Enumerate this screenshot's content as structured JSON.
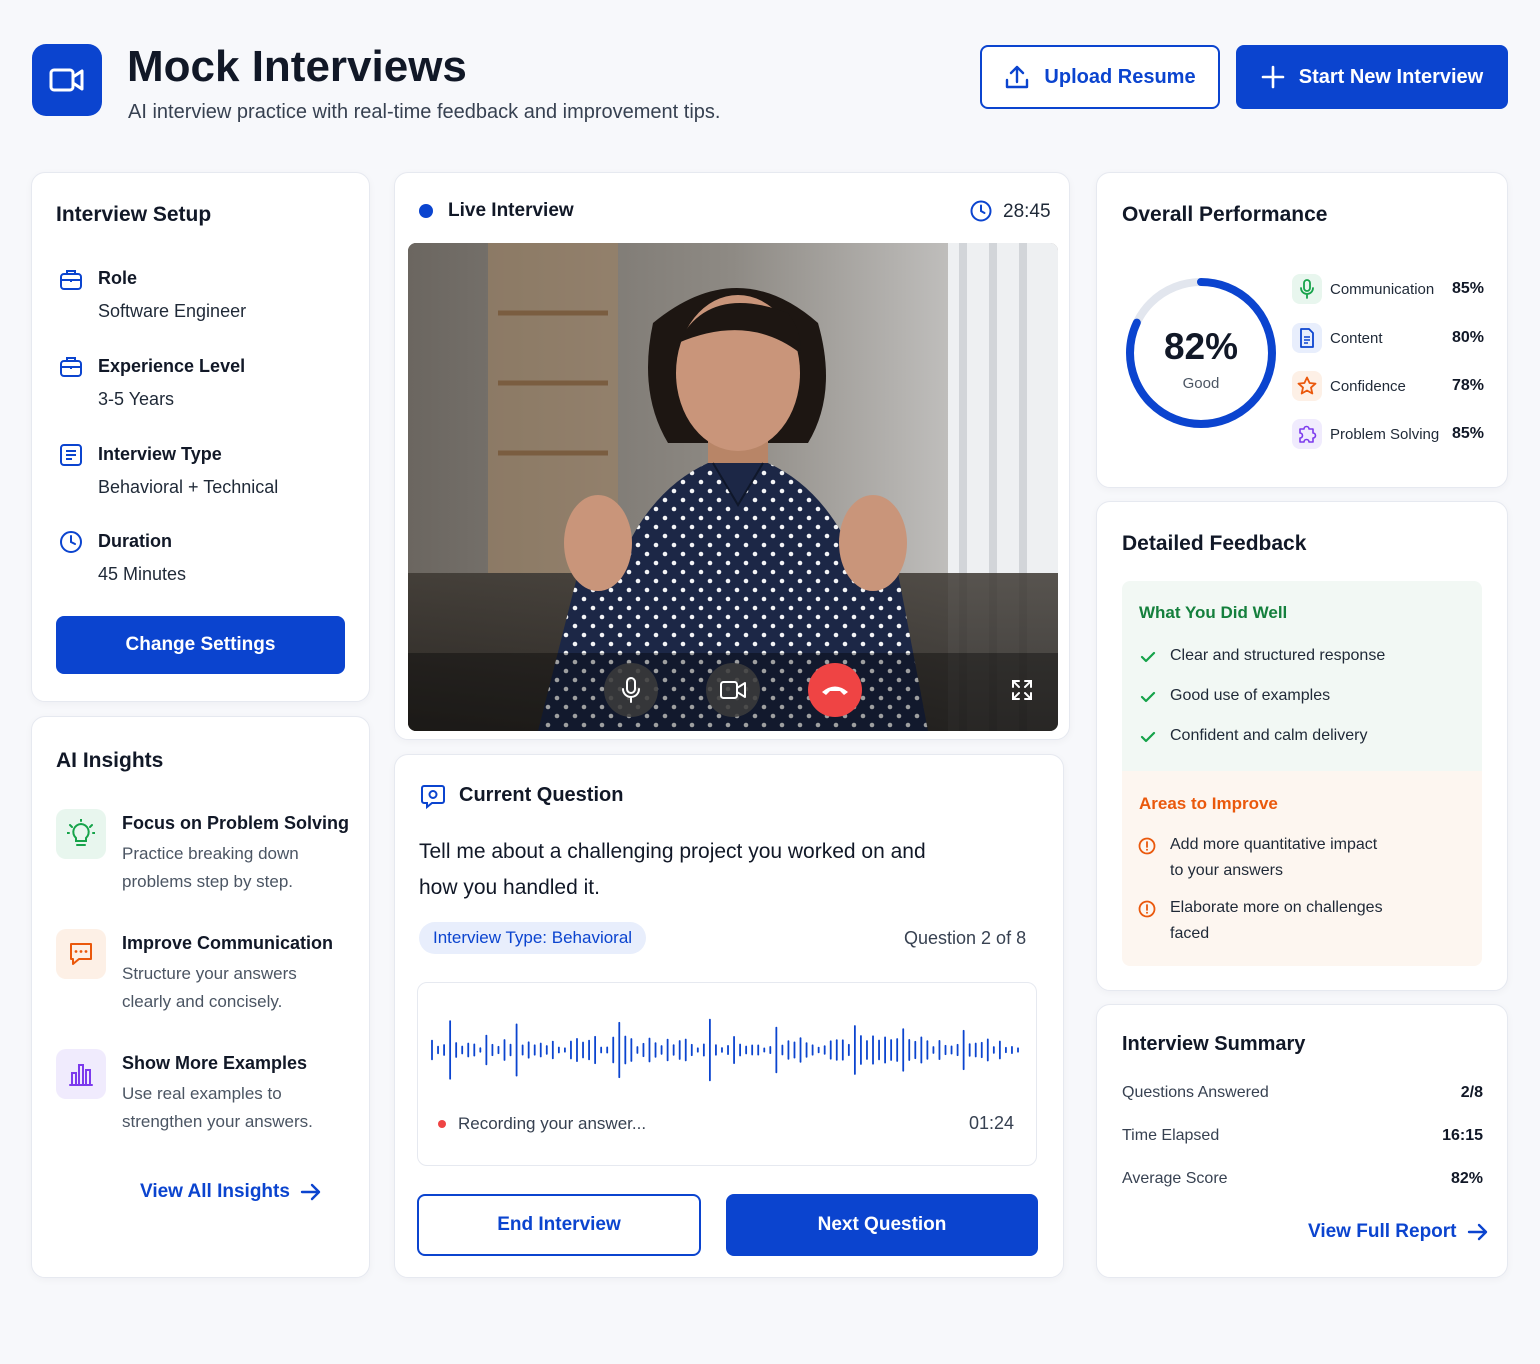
{
  "header": {
    "title": "Mock Interviews",
    "subtitle": "AI interview practice with real-time feedback and improvement tips.",
    "upload_label": "Upload Resume",
    "start_label": "Start New Interview"
  },
  "setup": {
    "title": "Interview Setup",
    "items": [
      {
        "label": "Role",
        "value": "Software Engineer",
        "icon": "briefcase-icon"
      },
      {
        "label": "Experience Level",
        "value": "3-5 Years",
        "icon": "briefcase-icon"
      },
      {
        "label": "Interview Type",
        "value": "Behavioral + Technical",
        "icon": "list-icon"
      },
      {
        "label": "Duration",
        "value": "45 Minutes",
        "icon": "clock-icon"
      }
    ],
    "button_label": "Change Settings"
  },
  "insights": {
    "title": "AI Insights",
    "items": [
      {
        "title": "Focus on Problem Solving",
        "line1": "Practice breaking down",
        "line2": "problems step by step.",
        "icon": "lightbulb-icon",
        "color": "#16a34a"
      },
      {
        "title": "Improve Communication",
        "line1": "Structure your answers",
        "line2": "clearly and concisely.",
        "icon": "chat-icon",
        "color": "#ea580c"
      },
      {
        "title": "Show More Examples",
        "line1": "Use real examples to",
        "line2": "strengthen your answers.",
        "icon": "bar-chart-icon",
        "color": "#7c3aed"
      }
    ],
    "link_label": "View All Insights"
  },
  "live": {
    "label": "Live Interview",
    "timer": "28:45"
  },
  "question": {
    "title": "Current Question",
    "line1": "Tell me about a challenging project you worked on and",
    "line2": "how you handled it.",
    "type_badge": "Interview Type: Behavioral",
    "counter": "Question 2 of 8",
    "recording_label": "Recording your answer...",
    "recording_time": "01:24",
    "end_label": "End Interview",
    "next_label": "Next Question"
  },
  "performance": {
    "title": "Overall Performance",
    "score": 82,
    "score_text": "82%",
    "score_label": "Good",
    "metrics": [
      {
        "name": "Communication",
        "value": "85%",
        "icon": "microphone-icon",
        "color": "#16a34a"
      },
      {
        "name": "Content",
        "value": "80%",
        "icon": "document-icon",
        "color": "#0b44cf"
      },
      {
        "name": "Confidence",
        "value": "78%",
        "icon": "star-icon",
        "color": "#ea580c"
      },
      {
        "name": "Problem Solving",
        "value": "85%",
        "icon": "puzzle-icon",
        "color": "#7c3aed"
      }
    ]
  },
  "feedback": {
    "title": "Detailed Feedback",
    "well_title": "What You Did Well",
    "well_items": [
      "Clear and structured response",
      "Good use of examples",
      "Confident and calm delivery"
    ],
    "improve_title": "Areas to Improve",
    "improve_items": [
      {
        "line1": "Add more quantitative impact",
        "line2": "to your answers"
      },
      {
        "line1": "Elaborate more on challenges",
        "line2": "faced"
      }
    ],
    "colors": {
      "green": "#15803d",
      "orange": "#ea580c"
    }
  },
  "summary": {
    "title": "Interview Summary",
    "rows": [
      {
        "label": "Questions Answered",
        "value": "2/8"
      },
      {
        "label": "Time Elapsed",
        "value": "16:15"
      },
      {
        "label": "Average Score",
        "value": "82%"
      }
    ],
    "link_label": "View Full Report"
  },
  "colors": {
    "accent": "#0b44cf",
    "danger": "#ef4444"
  }
}
